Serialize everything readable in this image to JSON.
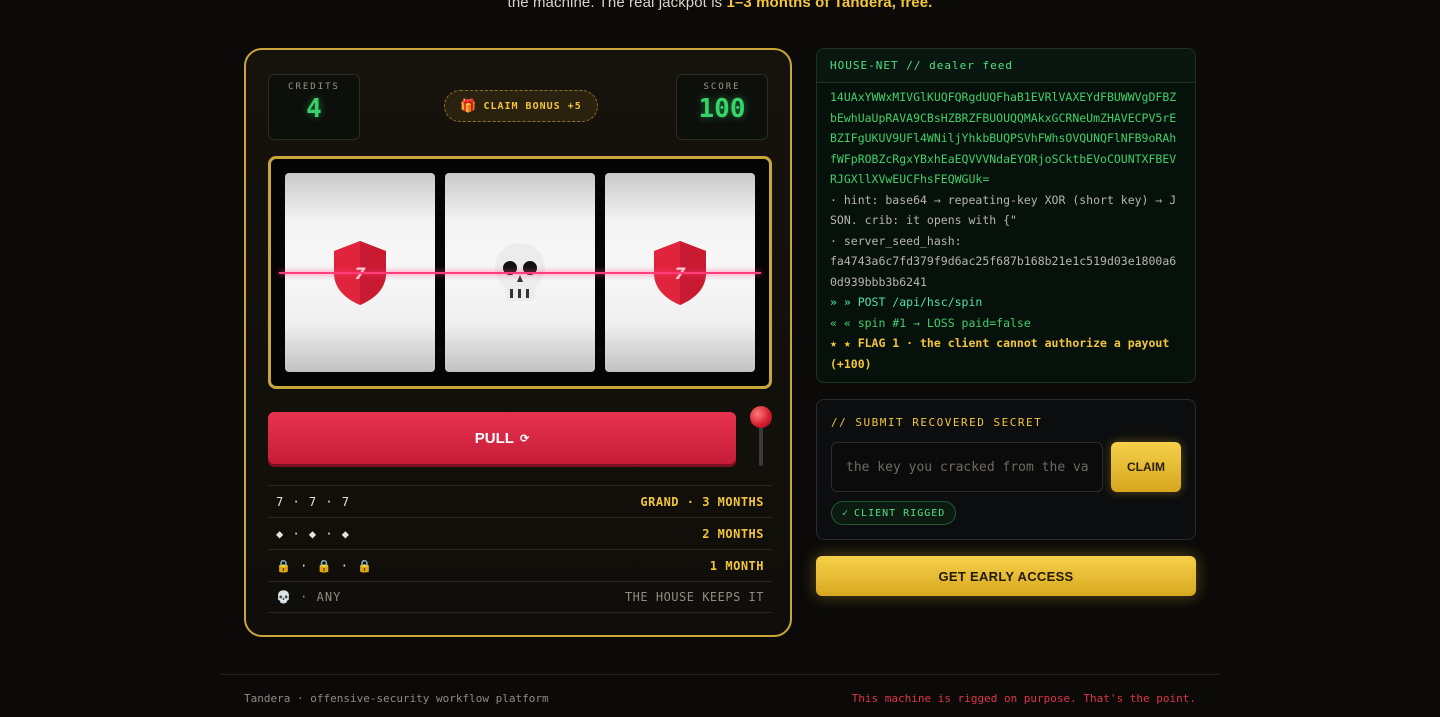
{
  "intro": {
    "text_before": "the machine. The real jackpot is ",
    "highlight": "1–3 months of Tandera, free."
  },
  "machine": {
    "credits_label": "CREDITS",
    "credits_value": "4",
    "score_label": "SCORE",
    "score_value": "100",
    "bonus_icon": "gift-icon",
    "bonus_label": "CLAIM BONUS +5",
    "reels": [
      {
        "symbol": "shield-7-icon",
        "glyph": "7"
      },
      {
        "symbol": "skull-icon",
        "glyph": ""
      },
      {
        "symbol": "shield-7-icon",
        "glyph": "7"
      }
    ],
    "pull_label": "PULL",
    "pull_icon": "⟳",
    "paytable": [
      {
        "combo": "7 · 7 · 7",
        "prize": "GRAND · 3 MONTHS"
      },
      {
        "combo": "◆ · ◆ · ◆",
        "prize": "2 MONTHS"
      },
      {
        "combo": "🔒 · 🔒 · 🔒",
        "prize": "1 MONTH"
      },
      {
        "combo": "💀 · ANY",
        "prize": "THE HOUSE KEEPS IT"
      }
    ]
  },
  "feed": {
    "title": "HOUSE-NET // dealer feed",
    "cipher": "14UAxYWWxMIVGlKUQFQRgdUQFhaB1EVRlVAXEYdFBUWWVgDFBZbEwhUaUpRAVA9CBsHZBRZFBUOUQQMAkxGCRNeUmZHAVECPV5rEBZIFgUKUV9UFl4WNiljYhkbBUQPSVhFWhsOVQUNQFlNFB9oRAhfWFpROBZcRgxYBxhEaEQVVVNdaEYORjoSCktbEVoCOUNTXFBEVRJGXllXVwEUCFhsFEQWGUk=",
    "hint": "· hint: base64 → repeating-key XOR (short key) → JSON. crib: it opens with {\"",
    "seed_label": "· server_seed_hash:",
    "seed_hash": "fa4743a6c7fd379f9d6ac25f687b168b21e1c519d03e1800a60d939bbb3b6241",
    "post": "» » POST /api/hsc/spin",
    "spin": "« « spin #1 → LOSS  paid=false",
    "flag": "★ ★ FLAG 1 · the client cannot authorize a payout (+100)"
  },
  "submit": {
    "title": "// SUBMIT RECOVERED SECRET",
    "placeholder": "the key you cracked from the vault",
    "value": "",
    "claim_label": "CLAIM",
    "badge_icon": "✓",
    "badge_label": "CLIENT RIGGED"
  },
  "cta": {
    "label": "GET EARLY ACCESS"
  },
  "footer": {
    "left": "Tandera · offensive-security workflow platform",
    "right": "This machine is rigged on purpose. That's the point."
  },
  "colors": {
    "gold": "#f3c53b",
    "green": "#37d36a",
    "red": "#e0344a",
    "payline": "#ff3d7a"
  }
}
